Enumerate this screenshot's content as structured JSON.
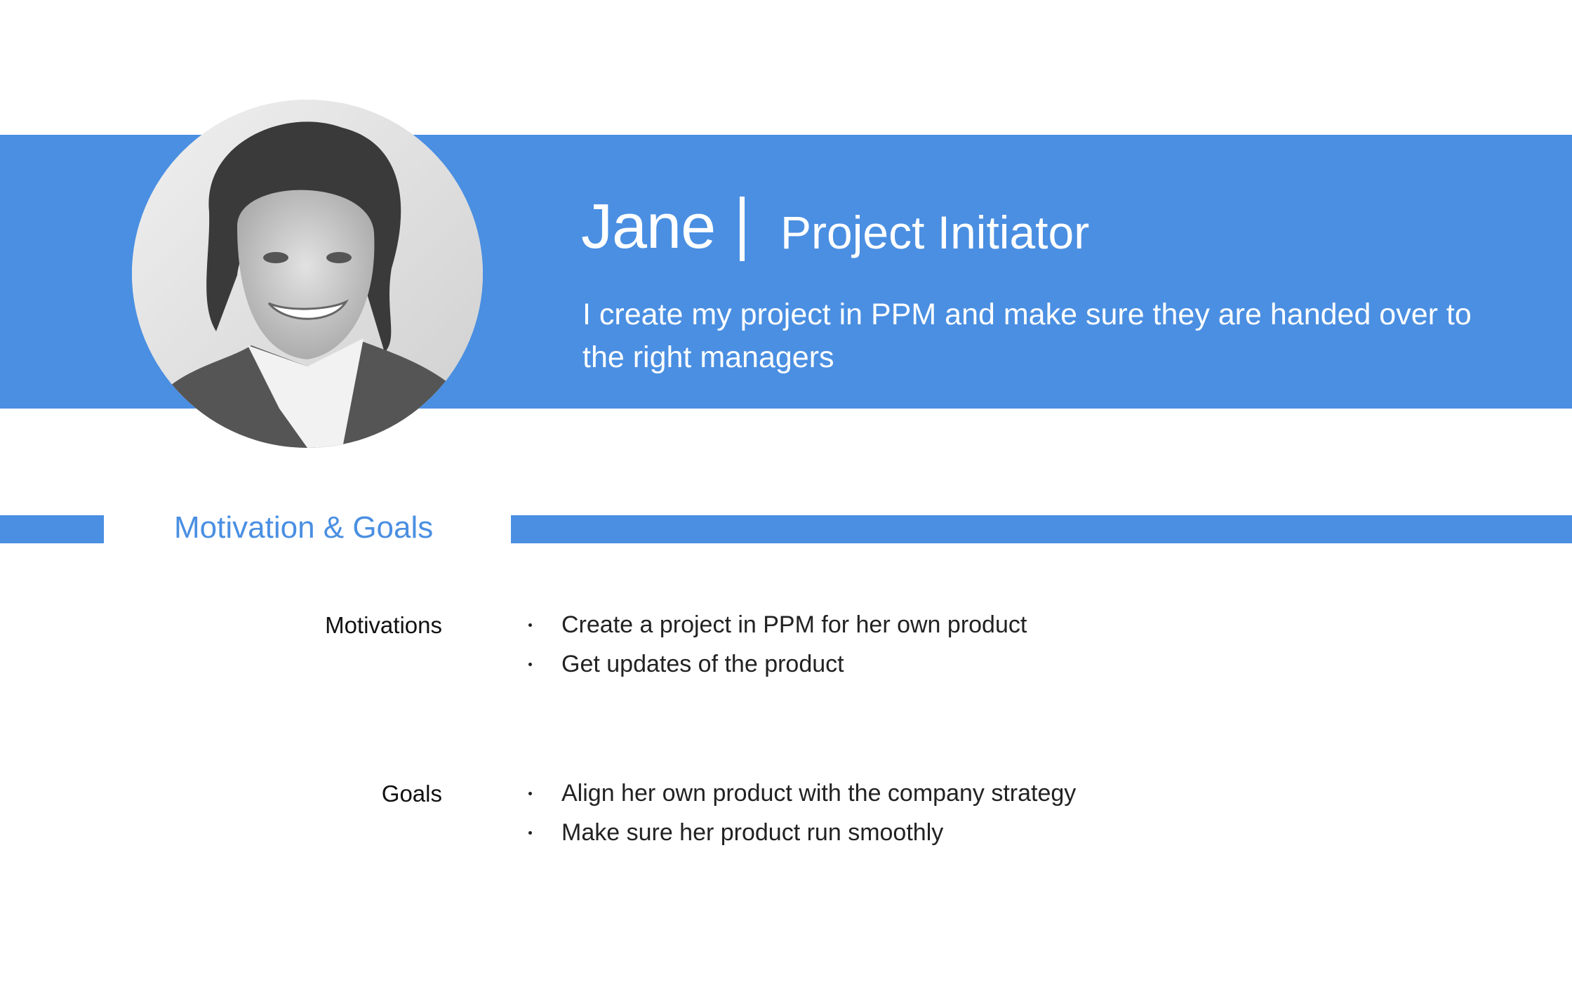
{
  "persona": {
    "name": "Jane",
    "role": "Project Initiator",
    "quote": "I create my project in PPM and make sure they are handed over to the right managers"
  },
  "section": {
    "title": "Motivation & Goals"
  },
  "rows": [
    {
      "label": "Motivations",
      "items": [
        "Create a project in PPM for her own product",
        "Get updates of the product"
      ]
    },
    {
      "label": "Goals",
      "items": [
        "Align her own product with the company strategy",
        "Make sure her product run smoothly"
      ]
    }
  ],
  "colors": {
    "accent": "#4A8FE2",
    "band_text": "#ffffff"
  },
  "icons": {
    "avatar": "persona-photo"
  }
}
